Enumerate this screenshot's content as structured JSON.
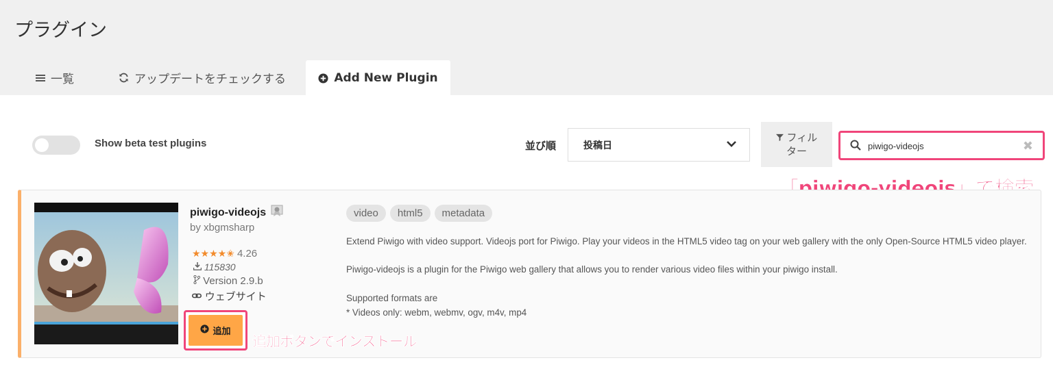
{
  "page": {
    "title": "プラグイン"
  },
  "tabs": {
    "list_label": "一覧",
    "update_label": "アップデートをチェックする",
    "add_label": "Add New Plugin"
  },
  "toolbar": {
    "beta_label": "Show beta test plugins",
    "beta_enabled": false,
    "sort_label": "並び順",
    "sort_value": "投稿日",
    "filter_line1": "フィル",
    "filter_line2": "ター",
    "search_value": "piwigo-videojs"
  },
  "annotations": {
    "search_note": "「piwigo-videojs」で検索",
    "install_note": "追加ボタンでインストール",
    "accent_color": "#f0457a"
  },
  "plugin": {
    "name": "piwigo-videojs",
    "author": "by xbgmsharp",
    "stars": "★★★★✬",
    "rating": "4.26",
    "downloads": "115830",
    "version": "Version 2.9.b",
    "website_label": "ウェブサイト",
    "add_label": "追加",
    "tags": [
      "video",
      "html5",
      "metadata"
    ],
    "desc1": "Extend Piwigo with video support. Videojs port for Piwigo. Play your videos in the HTML5 video tag on your web gallery with the only Open-Source HTML5 video player.",
    "desc2": "Piwigo-videojs is a plugin for the Piwigo web gallery that allows you to render various video files within your piwigo install.",
    "desc3": "Supported formats are",
    "desc4": "* Videos only: webm, webmv, ogv, m4v, mp4"
  }
}
